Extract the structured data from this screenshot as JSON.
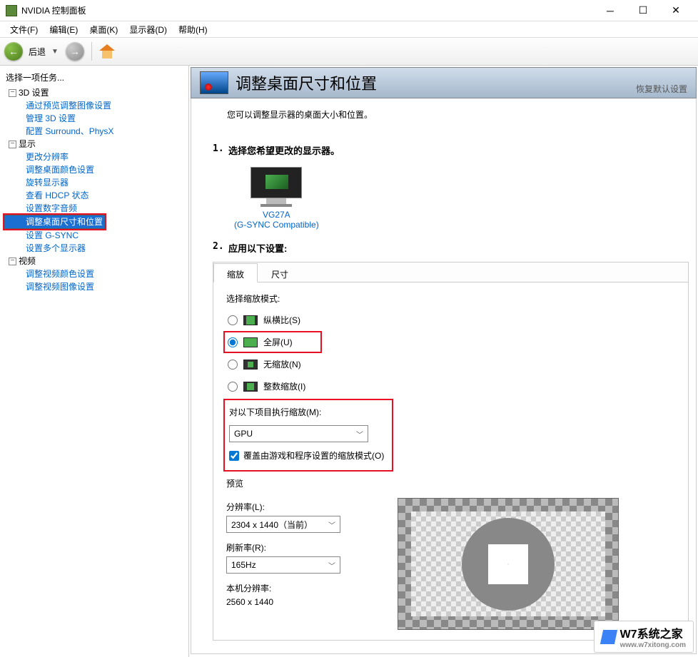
{
  "titlebar": {
    "title": "NVIDIA 控制面板"
  },
  "menubar": {
    "file": "文件(F)",
    "edit": "编辑(E)",
    "desktop": "桌面(K)",
    "display": "显示器(D)",
    "help": "帮助(H)"
  },
  "toolbar": {
    "back": "后退"
  },
  "sidebar": {
    "title": "选择一项任务...",
    "groups": [
      {
        "label": "3D 设置",
        "items": [
          "通过预览调整图像设置",
          "管理 3D 设置",
          "配置 Surround、PhysX"
        ]
      },
      {
        "label": "显示",
        "items": [
          "更改分辨率",
          "调整桌面颜色设置",
          "旋转显示器",
          "查看 HDCP 状态",
          "设置数字音频",
          "调整桌面尺寸和位置",
          "设置 G-SYNC",
          "设置多个显示器"
        ]
      },
      {
        "label": "视频",
        "items": [
          "调整视频颜色设置",
          "调整视频图像设置"
        ]
      }
    ],
    "selected": "调整桌面尺寸和位置"
  },
  "header": {
    "title": "调整桌面尺寸和位置",
    "restore": "恢复默认设置"
  },
  "intro": "您可以调整显示器的桌面大小和位置。",
  "step1": {
    "num": "1.",
    "label": "选择您希望更改的显示器。"
  },
  "monitor": {
    "name": "VG27A",
    "compat": "(G-SYNC Compatible)"
  },
  "step2": {
    "num": "2.",
    "label": "应用以下设置:"
  },
  "tabs": {
    "scale": "缩放",
    "size": "尺寸"
  },
  "scale": {
    "mode_label": "选择缩放模式:",
    "aspect": "纵横比(S)",
    "fullscreen": "全屏(U)",
    "none": "无缩放(N)",
    "integer": "整数缩放(I)",
    "perform_label": "对以下项目执行缩放(M):",
    "perform_value": "GPU",
    "override": "覆盖由游戏和程序设置的缩放模式(O)"
  },
  "preview": {
    "label": "预览",
    "res_label": "分辨率(L):",
    "res_value": "2304 x 1440（当前）",
    "refresh_label": "刷新率(R):",
    "refresh_value": "165Hz",
    "native_label": "本机分辨率:",
    "native_value": "2560 x 1440"
  },
  "watermark": {
    "brand": "W7系统之家",
    "url": "www.w7xitong.com"
  }
}
